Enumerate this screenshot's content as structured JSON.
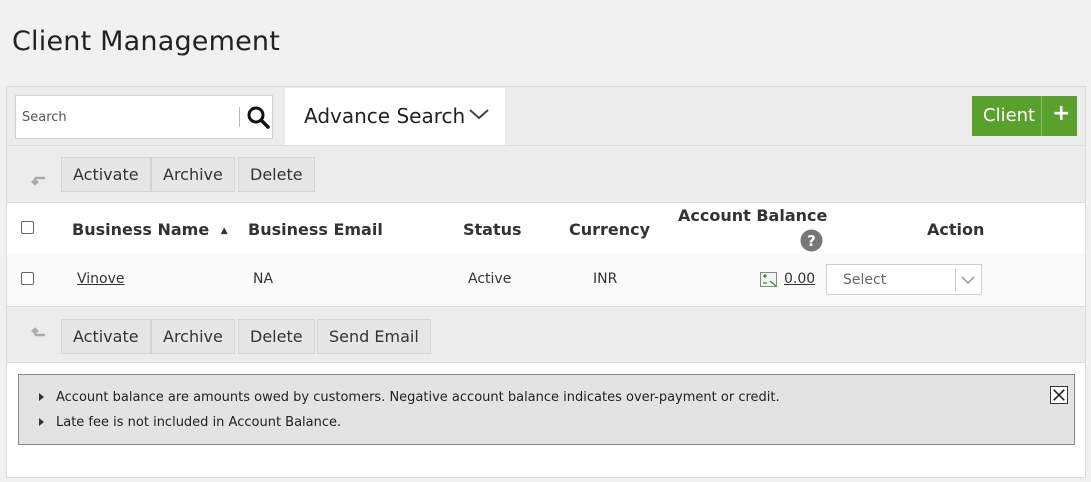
{
  "page": {
    "title": "Client Management"
  },
  "toolbar": {
    "search_placeholder": "Search",
    "advance_search_label": "Advance Search",
    "client_button_label": "Client",
    "client_button_icon": "+"
  },
  "bulk_actions_top": [
    "Activate",
    "Archive",
    "Delete"
  ],
  "bulk_actions_bottom": [
    "Activate",
    "Archive",
    "Delete",
    "Send Email"
  ],
  "table": {
    "columns": {
      "business_name": "Business Name",
      "business_email": "Business Email",
      "status": "Status",
      "currency": "Currency",
      "account_balance": "Account Balance",
      "action": "Action"
    },
    "sort_indicator": "▲",
    "rows": [
      {
        "business_name": "Vinove",
        "business_email": "NA",
        "status": "Active",
        "currency": "INR",
        "account_balance": "0.00",
        "action_placeholder": "Select"
      }
    ]
  },
  "info": {
    "lines": [
      "Account balance are amounts owed by customers. Negative account balance indicates over-payment or credit.",
      "Late fee is not included in Account Balance."
    ]
  },
  "colors": {
    "accent_green": "#5aa02c",
    "panel_bg": "#ececec",
    "info_bg": "#e3e3e3"
  },
  "icons": [
    "search-icon",
    "chevron-down-icon",
    "plus-icon",
    "arrow-up-left-icon",
    "help-icon",
    "balance-icon",
    "close-icon",
    "caret-right-icon"
  ]
}
